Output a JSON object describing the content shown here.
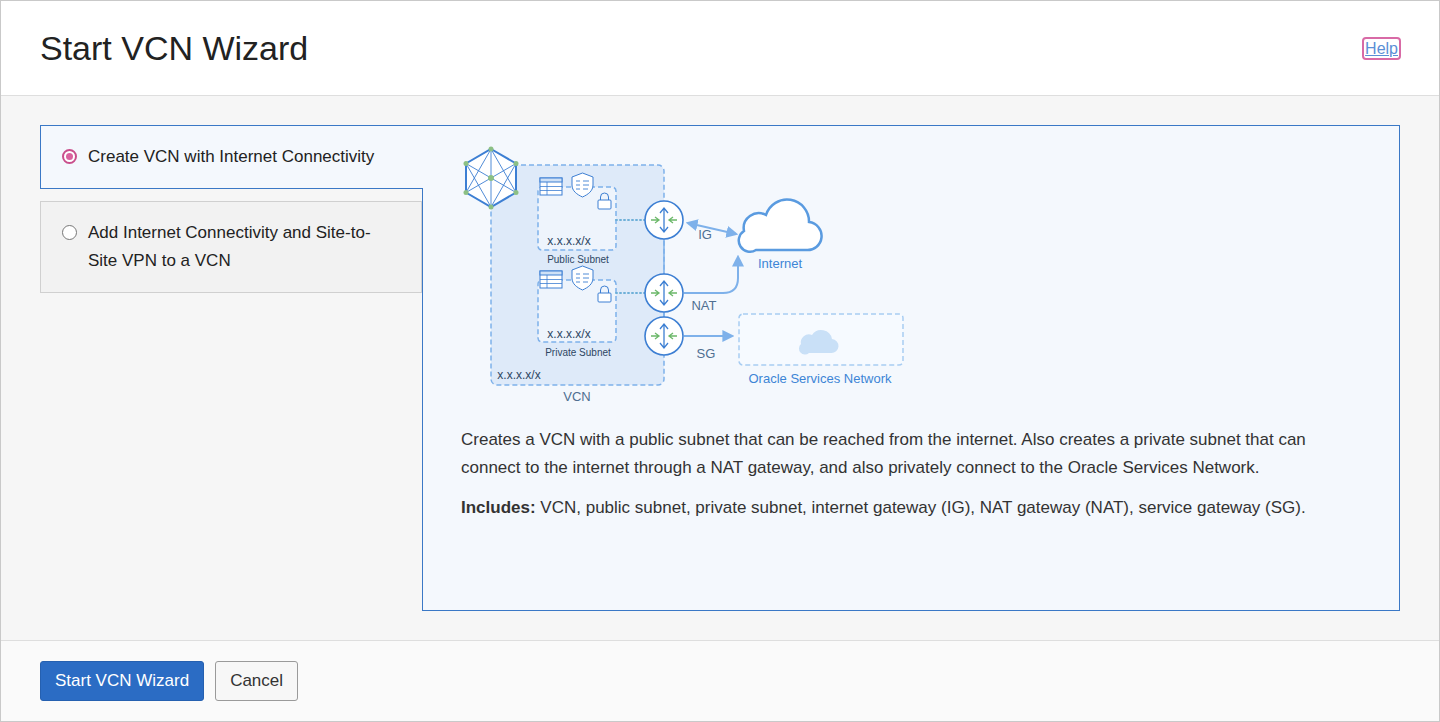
{
  "dialog": {
    "title": "Start VCN Wizard",
    "help": "Help"
  },
  "options": [
    {
      "label": "Create VCN with Internet Connectivity",
      "selected": true
    },
    {
      "label": "Add Internet Connectivity and Site-to-Site VPN to a VCN",
      "selected": false
    }
  ],
  "diagram": {
    "vcn": {
      "label": "VCN",
      "cidr": "x.x.x.x/x"
    },
    "subnets": [
      {
        "label": "Public Subnet",
        "cidr": "x.x.x.x/x"
      },
      {
        "label": "Private Subnet",
        "cidr": "x.x.x.x/x"
      }
    ],
    "gateways": [
      "IG",
      "NAT",
      "SG"
    ],
    "internet": "Internet",
    "services_network": "Oracle Services Network"
  },
  "description": "Creates a VCN with a public subnet that can be reached from the internet. Also creates a private subnet that can connect to the internet through a NAT gateway, and also privately connect to the Oracle Services Network.",
  "includes": {
    "label": "Includes:",
    "text": "VCN, public subnet, private subnet, internet gateway (IG), NAT gateway (NAT), service gateway (SG)."
  },
  "buttons": [
    {
      "label": "Start VCN Wizard",
      "kind": "primary"
    },
    {
      "label": "Cancel",
      "kind": "secondary"
    }
  ]
}
